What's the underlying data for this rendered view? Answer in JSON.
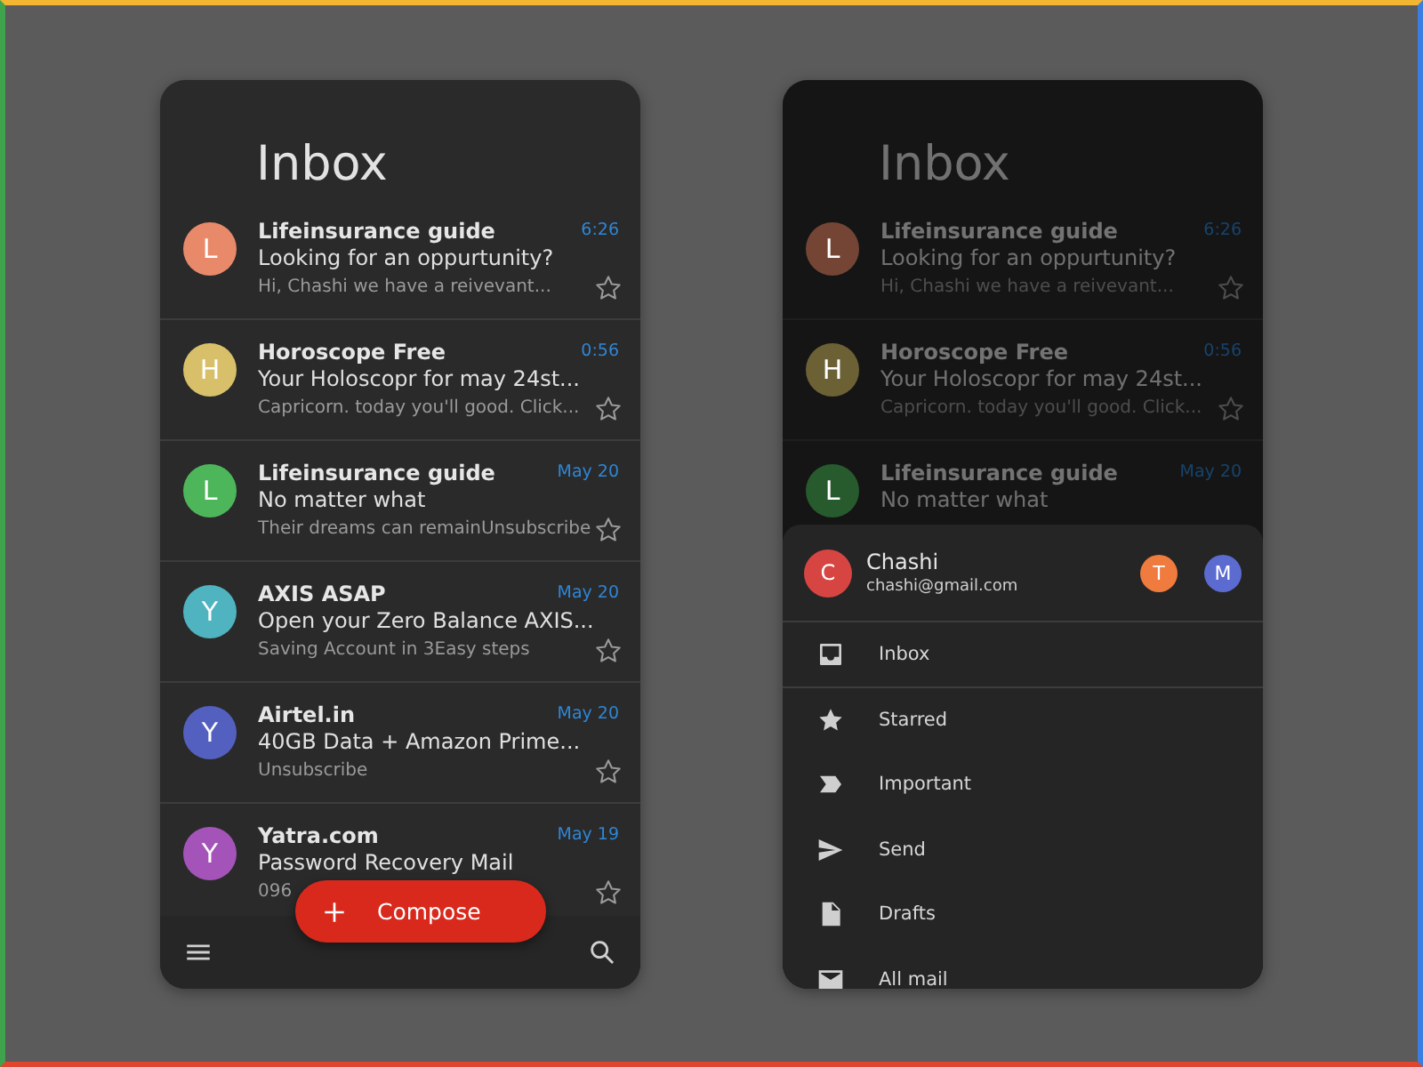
{
  "screens": [
    {
      "title": "Inbox",
      "dimmed": false,
      "emails": [
        {
          "initial": "L",
          "color": "#e8896a",
          "sender": "Lifeinsurance guide",
          "time": "6:26",
          "subject": "Looking for an oppurtunity?",
          "preview": "Hi, Chashi we have a reivevant...",
          "starred": false
        },
        {
          "initial": "H",
          "color": "#d8c06a",
          "sender": "Horoscope Free",
          "time": "0:56",
          "subject": "Your Holoscopr for may 24st...",
          "preview": "Capricorn. today you'll good. Click...",
          "starred": false
        },
        {
          "initial": "L",
          "color": "#4db65a",
          "sender": "Lifeinsurance guide",
          "time": "May 20",
          "subject": "No matter what",
          "preview": "Their dreams can remainUnsubscribe",
          "starred": false
        },
        {
          "initial": "Y",
          "color": "#4fb3c0",
          "sender": "AXIS ASAP",
          "time": "May 20",
          "subject": "Open your Zero Balance AXIS...",
          "preview": "Saving Account in 3Easy steps",
          "starred": false
        },
        {
          "initial": "Y",
          "color": "#5460c0",
          "sender": "Airtel.in",
          "time": "May 20",
          "subject": "40GB Data + Amazon Prime...",
          "preview": "Unsubscribe",
          "starred": false
        },
        {
          "initial": "Y",
          "color": "#a454b8",
          "sender": "Yatra.com",
          "time": "May 19",
          "subject": "Password Recovery Mail",
          "preview": "096",
          "starred": false
        }
      ],
      "compose": "Compose"
    },
    {
      "title": "Inbox",
      "dimmed": true,
      "emails": [
        {
          "initial": "L",
          "color": "#744535",
          "sender": "Lifeinsurance guide",
          "time": "6:26",
          "subject": "Looking for an oppurtunity?",
          "preview": "Hi, Chashi we have a reivevant...",
          "starred": false
        },
        {
          "initial": "H",
          "color": "#6c6035",
          "sender": "Horoscope Free",
          "time": "0:56",
          "subject": "Your Holoscopr for may 24st...",
          "preview": "Capricorn. today you'll good. Click...",
          "starred": false
        },
        {
          "initial": "L",
          "color": "#275b2d",
          "sender": "Lifeinsurance guide",
          "time": "May 20",
          "subject": "No matter what"
        }
      ],
      "drawer": {
        "account": {
          "initial": "C",
          "color": "#d64541",
          "name": "Chashi",
          "email": "chashi@gmail.com"
        },
        "other_accounts": [
          {
            "initial": "T",
            "color": "#f07b3f"
          },
          {
            "initial": "M",
            "color": "#5b6bd0"
          }
        ],
        "items": [
          {
            "kind": "inbox",
            "label": "Inbox"
          },
          {
            "kind": "starred",
            "label": "Starred"
          },
          {
            "kind": "important",
            "label": "Important"
          },
          {
            "kind": "send",
            "label": "Send"
          },
          {
            "kind": "drafts",
            "label": "Drafts"
          },
          {
            "kind": "allmail",
            "label": "All mail"
          }
        ]
      }
    }
  ]
}
